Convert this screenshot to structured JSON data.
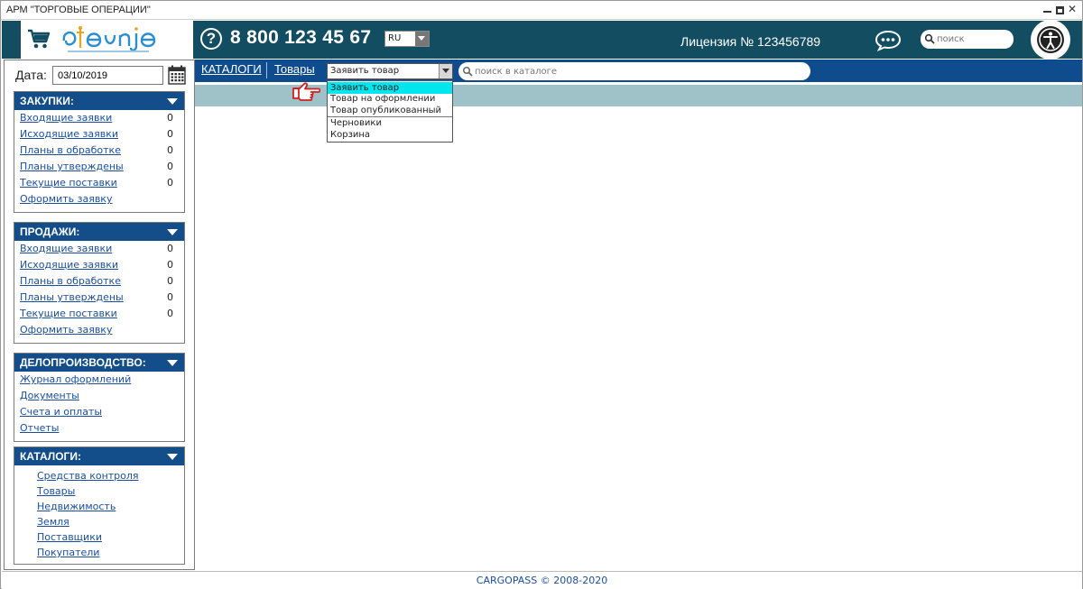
{
  "window": {
    "title": "АРМ \"ТОРГОВЫЕ ОПЕРАЦИИ\""
  },
  "header": {
    "phone": "8 800 123 45 67",
    "lang": "RU",
    "license": "Лицензия № 123456789",
    "search_placeholder": "поиск",
    "brand_color": "#134d61"
  },
  "sidebar": {
    "date_label": "Дата:",
    "date_value": "03/10/2019",
    "purchases": {
      "title": "ЗАКУПКИ:",
      "items": [
        {
          "label": "Входящие заявки",
          "count": "0"
        },
        {
          "label": "Исходящие заявки",
          "count": "0"
        },
        {
          "label": "Планы в обработке",
          "count": "0"
        },
        {
          "label": "Планы утверждены",
          "count": "0"
        },
        {
          "label": "Текущие поставки",
          "count": "0"
        },
        {
          "label": "Оформить заявку",
          "count": ""
        }
      ]
    },
    "sales": {
      "title": "ПРОДАЖИ:",
      "items": [
        {
          "label": "Входящие заявки",
          "count": "0"
        },
        {
          "label": "Исходящие заявки",
          "count": "0"
        },
        {
          "label": "Планы в обработке",
          "count": "0"
        },
        {
          "label": "Планы утверждены",
          "count": "0"
        },
        {
          "label": "Текущие поставки",
          "count": "0"
        },
        {
          "label": "Оформить заявку",
          "count": ""
        }
      ]
    },
    "records": {
      "title": "ДЕЛОПРОИЗВОДСТВО:",
      "items": [
        {
          "label": "Журнал оформлений"
        },
        {
          "label": "Документы"
        },
        {
          "label": "Счета и оплаты"
        },
        {
          "label": "Отчеты"
        }
      ]
    },
    "catalogs": {
      "title": "КАТАЛОГИ:",
      "items": [
        {
          "label": "Средства контроля"
        },
        {
          "label": "Товары"
        },
        {
          "label": "Недвижимость"
        },
        {
          "label": "Земля"
        },
        {
          "label": "Поставщики"
        },
        {
          "label": "Покупатели"
        }
      ]
    }
  },
  "navbar": {
    "breadcrumb_catalogs": "КАТАЛОГИ",
    "breadcrumb_goods": "Товары",
    "combo_value": "Заявить товар",
    "search_placeholder": "поиск в каталоге"
  },
  "dropdown": {
    "options": [
      "Заявить товар",
      "Товар на оформлении",
      "Товар опубликованный",
      "Черновики",
      "Корзина"
    ],
    "selected_index": 0
  },
  "footer": {
    "copyright": "CARGOPASS © 2008-2020"
  }
}
